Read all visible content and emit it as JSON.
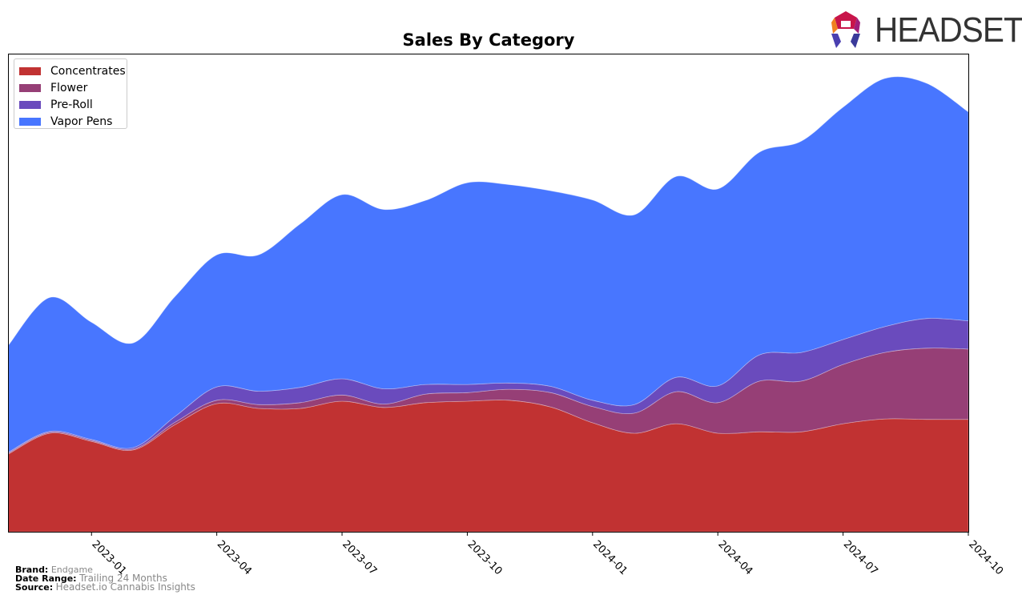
{
  "header": {
    "logo_text": "HEADSET",
    "logo_icon": "headset-logo-icon"
  },
  "footer": {
    "brand_label": "Brand:",
    "brand_value": "Endgame",
    "date_range_label": "Date Range:",
    "date_range_value": "Trailing 24 Months",
    "source_label": "Source:",
    "source_value": "Headset.io Cannabis Insights"
  },
  "chart_data": {
    "type": "area",
    "stacked": true,
    "title": "Sales By Category",
    "xlabel": "",
    "ylabel": "",
    "y_tick_labels_visible": false,
    "ylim": [
      0,
      100
    ],
    "grid": false,
    "legend_position": "top-left",
    "x": [
      "2022-11",
      "2022-12",
      "2023-01",
      "2023-02",
      "2023-03",
      "2023-04",
      "2023-05",
      "2023-06",
      "2023-07",
      "2023-08",
      "2023-09",
      "2023-10",
      "2023-11",
      "2023-12",
      "2024-01",
      "2024-02",
      "2024-03",
      "2024-04",
      "2024-05",
      "2024-06",
      "2024-07",
      "2024-08",
      "2024-09",
      "2024-10"
    ],
    "x_ticks": [
      "2023-01",
      "2023-04",
      "2023-07",
      "2023-10",
      "2024-01",
      "2024-04",
      "2024-07",
      "2024-10"
    ],
    "series": [
      {
        "name": "Concentrates",
        "color": "#c13232",
        "values": [
          16.2,
          20.6,
          18.9,
          17.1,
          22.4,
          26.8,
          25.8,
          25.8,
          27.3,
          26.0,
          27.0,
          27.3,
          27.5,
          26.1,
          22.8,
          20.6,
          22.6,
          20.6,
          20.9,
          20.9,
          22.6,
          23.6,
          23.5,
          23.5
        ]
      },
      {
        "name": "Flower",
        "color": "#963f76",
        "values": [
          0.2,
          0.2,
          0.2,
          0.2,
          0.5,
          0.7,
          0.8,
          1.2,
          1.3,
          0.7,
          1.8,
          1.8,
          2.3,
          3.0,
          3.4,
          4.2,
          6.7,
          6.4,
          10.6,
          10.6,
          12.4,
          13.9,
          14.9,
          14.7
        ]
      },
      {
        "name": "Pre-Roll",
        "color": "#6a4bbd",
        "values": [
          0.2,
          0.2,
          0.2,
          0.3,
          1.2,
          2.8,
          2.8,
          3.2,
          3.4,
          3.2,
          2.0,
          1.7,
          1.3,
          1.3,
          1.3,
          1.8,
          3.0,
          3.5,
          5.5,
          6.0,
          5.2,
          5.4,
          6.2,
          5.9
        ]
      },
      {
        "name": "Vapor Pens",
        "color": "#4876ff",
        "values": [
          22.3,
          28.0,
          24.5,
          21.9,
          25.1,
          27.6,
          28.5,
          34.2,
          38.5,
          37.5,
          38.5,
          42.2,
          41.5,
          40.9,
          41.9,
          39.7,
          42.0,
          41.2,
          42.4,
          44.2,
          48.6,
          51.9,
          49.2,
          43.7
        ]
      }
    ]
  }
}
